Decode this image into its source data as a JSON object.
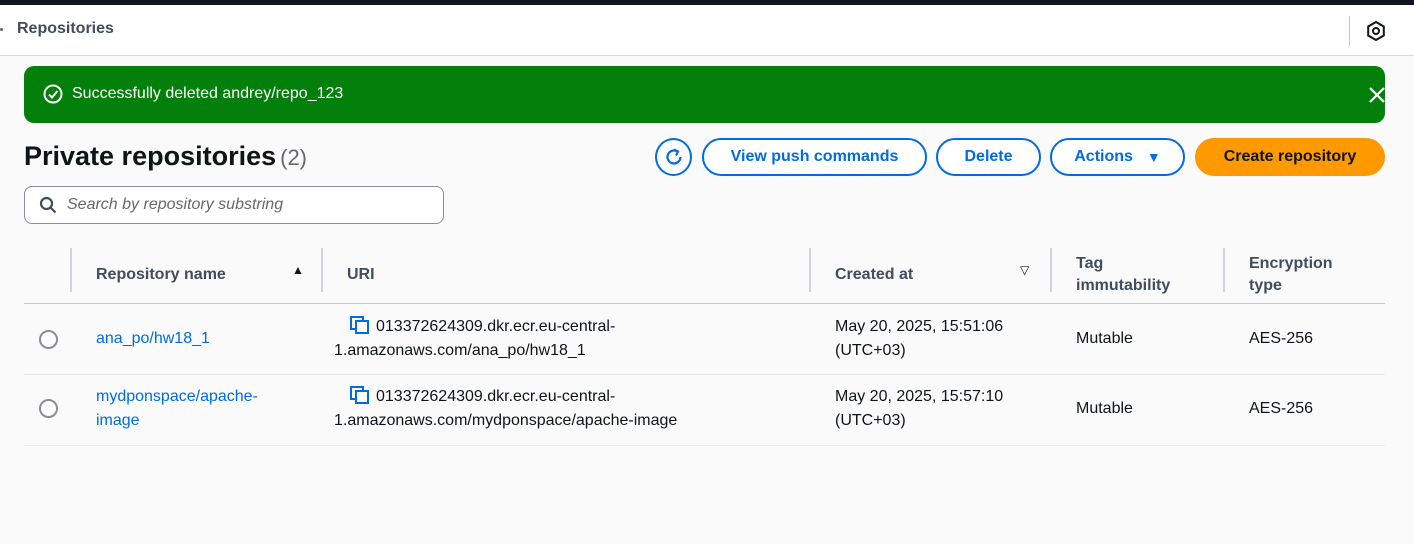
{
  "header": {
    "title": "Repositories"
  },
  "flash": {
    "message": "Successfully deleted andrey/repo_123"
  },
  "page": {
    "title": "Private repositories",
    "count": "(2)"
  },
  "toolbar": {
    "view_push_commands": "View push commands",
    "delete": "Delete",
    "actions": "Actions",
    "create_repository": "Create repository"
  },
  "search": {
    "placeholder": "Search by repository substring",
    "value": ""
  },
  "table": {
    "headers": {
      "name": "Repository name",
      "uri": "URI",
      "created": "Created at",
      "tag_line1": "Tag",
      "tag_line2": "immutability",
      "enc_line1": "Encryption",
      "enc_line2": "type"
    },
    "rows": [
      {
        "name": "ana_po/hw18_1",
        "uri": "013372624309.dkr.ecr.eu-central-1.amazonaws.com/ana_po/hw18_1",
        "created": "May 20, 2025, 15:51:06 (UTC+03)",
        "tag_immutability": "Mutable",
        "encryption": "AES-256"
      },
      {
        "name": "mydponspace/apache-image",
        "uri": "013372624309.dkr.ecr.eu-central-1.amazonaws.com/mydponspace/apache-image",
        "created": "May 20, 2025, 15:57:10 (UTC+03)",
        "tag_immutability": "Mutable",
        "encryption": "AES-256"
      }
    ]
  },
  "colors": {
    "success": "#037f0c",
    "primary": "#006ce0",
    "accent": "#ff9900"
  },
  "icons": {
    "flash": "check-circle-icon",
    "close": "close-icon",
    "refresh": "refresh-icon",
    "caret": "caret-down-icon",
    "search": "search-icon",
    "copy": "copy-icon",
    "settings": "settings-icon"
  }
}
